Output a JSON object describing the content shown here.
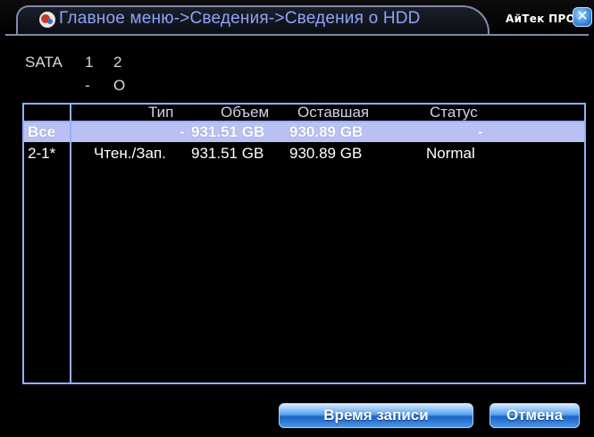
{
  "title": {
    "breadcrumb": "Главное меню->Сведения->Сведения о HDD",
    "brand": "АйТек ПРО",
    "close_glyph": "✕"
  },
  "sata": {
    "label": "SATA",
    "ports": [
      "1",
      "2"
    ],
    "states": [
      "-",
      "O"
    ]
  },
  "table": {
    "headers": [
      "Тип",
      "Объем",
      "Оставшая",
      "Статус"
    ],
    "rows": [
      {
        "id": "Все",
        "type": "-",
        "capacity": "931.51 GB",
        "remaining": "930.89 GB",
        "status": "-",
        "selected": true
      },
      {
        "id": "2-1*",
        "type": "Чтен./Зап.",
        "capacity": "931.51 GB",
        "remaining": "930.89 GB",
        "status": "Normal",
        "selected": false
      }
    ]
  },
  "buttons": {
    "record_time": "Время записи",
    "cancel": "Отмена"
  },
  "colors": {
    "accent": "#8fb2ff",
    "selected_row": "#b9c1f4",
    "title_text": "#8ea3ff"
  }
}
